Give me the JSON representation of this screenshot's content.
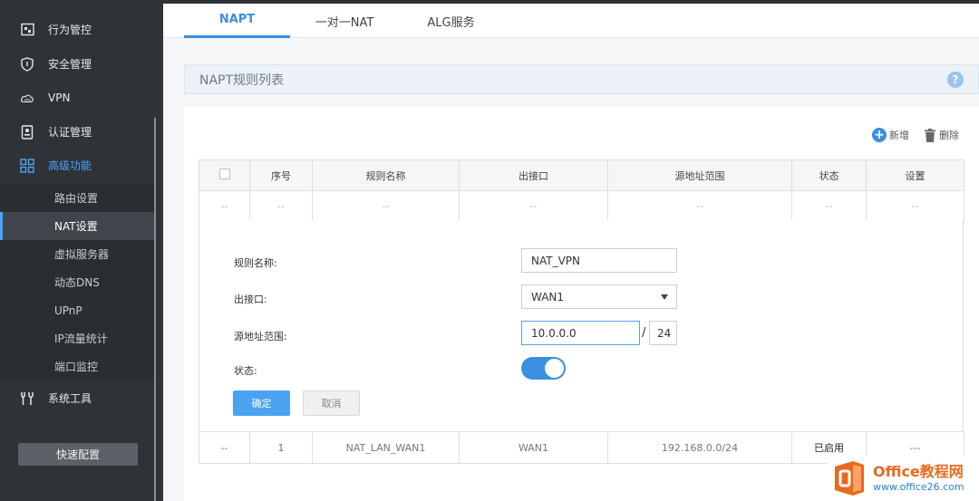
{
  "sidebar": {
    "items": [
      {
        "label": "行为管控",
        "icon": "behavior-icon"
      },
      {
        "label": "安全管理",
        "icon": "shield-icon"
      },
      {
        "label": "VPN",
        "icon": "vpn-cloud-icon"
      },
      {
        "label": "认证管理",
        "icon": "auth-icon"
      },
      {
        "label": "高级功能",
        "icon": "grid-icon"
      }
    ],
    "subitems": [
      "路由设置",
      "NAT设置",
      "虚拟服务器",
      "动态DNS",
      "UPnP",
      "IP流量统计",
      "端口监控"
    ],
    "tools": {
      "label": "系统工具",
      "icon": "tools-icon"
    },
    "quick_config": "快速配置",
    "active_sub": "NAT设置"
  },
  "tabs": [
    {
      "label": "NAPT"
    },
    {
      "label": "一对一NAT"
    },
    {
      "label": "ALG服务"
    }
  ],
  "section_title": "NAPT规则列表",
  "help": "?",
  "toolbar": {
    "add": "新增",
    "delete": "删除"
  },
  "table": {
    "headers": [
      "序号",
      "规则名称",
      "出接口",
      "源地址范围",
      "状态",
      "设置"
    ],
    "placeholder_row": [
      "--",
      "--",
      "--",
      "--",
      "--",
      "--",
      "--"
    ],
    "row1": [
      "--",
      "1",
      "NAT_LAN_WAN1",
      "WAN1",
      "192.168.0.0/24",
      "已启用",
      "---"
    ]
  },
  "form": {
    "name_label": "规则名称:",
    "name_value": "NAT_VPN",
    "iface_label": "出接口:",
    "iface_value": "WAN1",
    "src_label": "源地址范围:",
    "src_ip": "10.0.0.0",
    "slash": "/",
    "src_mask": "24",
    "status_label": "状态:",
    "status_on": true,
    "ok": "确定",
    "cancel": "取消"
  },
  "watermark": {
    "line1": "Office教程网",
    "line2": "www.office26.com"
  },
  "colors": {
    "accent": "#3a8fe0",
    "sidebar": "#2f3338",
    "watermark_orange": "#e8691e"
  }
}
